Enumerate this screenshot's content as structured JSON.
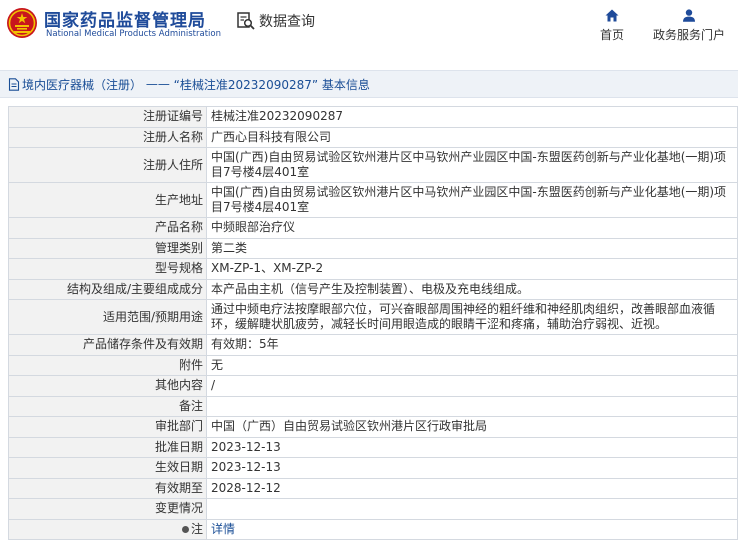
{
  "header": {
    "org_cn": "国家药品监督管理局",
    "org_en": "National Medical Products Administration",
    "query_label": "数据查询",
    "nav_home": "首页",
    "nav_portal": "政务服务门户"
  },
  "breadcrumb": {
    "section": "境内医疗器械（注册）",
    "separator": "——",
    "record": "“桂械注准20232090287”",
    "suffix": "基本信息"
  },
  "rows": [
    {
      "label": "注册证编号",
      "value": "桂械注准20232090287"
    },
    {
      "label": "注册人名称",
      "value": "广西心目科技有限公司"
    },
    {
      "label": "注册人住所",
      "value": "中国(广西)自由贸易试验区钦州港片区中马钦州产业园区中国-东盟医药创新与产业化基地(一期)项目7号楼4层401室"
    },
    {
      "label": "生产地址",
      "value": "中国(广西)自由贸易试验区钦州港片区中马钦州产业园区中国-东盟医药创新与产业化基地(一期)项目7号楼4层401室"
    },
    {
      "label": "产品名称",
      "value": "中频眼部治疗仪"
    },
    {
      "label": "管理类别",
      "value": "第二类"
    },
    {
      "label": "型号规格",
      "value": "XM-ZP-1、XM-ZP-2"
    },
    {
      "label": "结构及组成/主要组成成分",
      "value": "本产品由主机（信号产生及控制装置）、电极及充电线组成。"
    },
    {
      "label": "适用范围/预期用途",
      "value": "通过中频电疗法按摩眼部穴位，可兴奋眼部周围神经的粗纤维和神经肌肉组织，改善眼部血液循环，缓解睫状肌疲劳，减轻长时间用眼造成的眼睛干涩和疼痛，辅助治疗弱视、近视。"
    },
    {
      "label": "产品储存条件及有效期",
      "value": "有效期：5年"
    },
    {
      "label": "附件",
      "value": "无"
    },
    {
      "label": "其他内容",
      "value": "/"
    },
    {
      "label": "备注",
      "value": ""
    },
    {
      "label": "审批部门",
      "value": "中国（广西）自由贸易试验区钦州港片区行政审批局"
    },
    {
      "label": "批准日期",
      "value": "2023-12-13"
    },
    {
      "label": "生效日期",
      "value": "2023-12-13"
    },
    {
      "label": "有效期至",
      "value": "2028-12-12"
    },
    {
      "label": "变更情况",
      "value": ""
    }
  ],
  "note_row": {
    "label": "注",
    "link": "详情"
  },
  "colors": {
    "brand_blue": "#1f4b9a",
    "link_blue": "#1a4e96",
    "label_bg": "#f2f2f2",
    "border": "#d4d9e0",
    "emblem_red": "#c8161d"
  },
  "icons": {
    "logo": "national-emblem-icon",
    "query": "search-document-icon",
    "home": "home-icon",
    "portal": "user-icon",
    "breadcrumb": "document-icon"
  }
}
